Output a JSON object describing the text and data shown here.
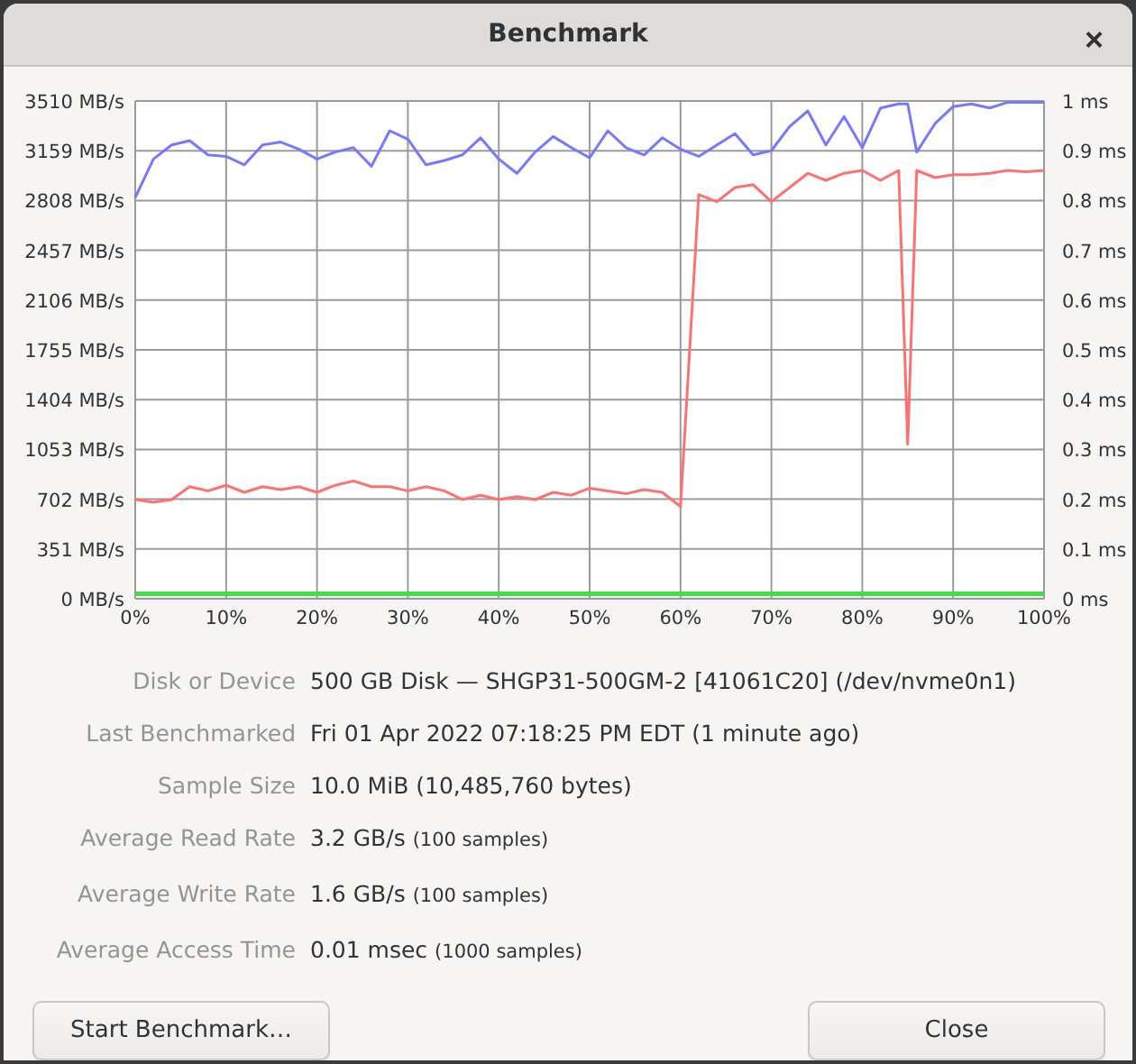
{
  "window": {
    "title": "Benchmark",
    "close": "×"
  },
  "chart": {
    "chart_data": {
      "type": "line",
      "x": [
        0,
        2,
        4,
        6,
        8,
        10,
        12,
        14,
        16,
        18,
        20,
        22,
        24,
        26,
        28,
        30,
        32,
        34,
        36,
        38,
        40,
        42,
        44,
        46,
        48,
        50,
        52,
        54,
        56,
        58,
        60,
        62,
        64,
        66,
        68,
        70,
        72,
        74,
        76,
        78,
        80,
        82,
        84,
        85,
        86,
        88,
        90,
        92,
        94,
        96,
        98,
        100
      ],
      "grid": true,
      "xlim": [
        0,
        100
      ],
      "ylim": [
        0,
        3510
      ],
      "xticks": [
        {
          "value": 0,
          "label": "0%"
        },
        {
          "value": 10,
          "label": "10%"
        },
        {
          "value": 20,
          "label": "20%"
        },
        {
          "value": 30,
          "label": "30%"
        },
        {
          "value": 40,
          "label": "40%"
        },
        {
          "value": 50,
          "label": "50%"
        },
        {
          "value": 60,
          "label": "60%"
        },
        {
          "value": 70,
          "label": "70%"
        },
        {
          "value": 80,
          "label": "80%"
        },
        {
          "value": 90,
          "label": "90%"
        },
        {
          "value": 100,
          "label": "100%"
        }
      ],
      "yticks": [
        {
          "value": 0,
          "label": "0 MB/s"
        },
        {
          "value": 351,
          "label": "351 MB/s"
        },
        {
          "value": 702,
          "label": "702 MB/s"
        },
        {
          "value": 1053,
          "label": "1053 MB/s"
        },
        {
          "value": 1404,
          "label": "1404 MB/s"
        },
        {
          "value": 1755,
          "label": "1755 MB/s"
        },
        {
          "value": 2106,
          "label": "2106 MB/s"
        },
        {
          "value": 2457,
          "label": "2457 MB/s"
        },
        {
          "value": 2808,
          "label": "2808 MB/s"
        },
        {
          "value": 3159,
          "label": "3159 MB/s"
        },
        {
          "value": 3510,
          "label": "3510 MB/s"
        }
      ],
      "y2lim": [
        0,
        1
      ],
      "y2ticks": [
        {
          "value": 0,
          "label": "0 ms"
        },
        {
          "value": 0.1,
          "label": "0.1 ms"
        },
        {
          "value": 0.2,
          "label": "0.2 ms"
        },
        {
          "value": 0.3,
          "label": "0.3 ms"
        },
        {
          "value": 0.4,
          "label": "0.4 ms"
        },
        {
          "value": 0.5,
          "label": "0.5 ms"
        },
        {
          "value": 0.6,
          "label": "0.6 ms"
        },
        {
          "value": 0.7,
          "label": "0.7 ms"
        },
        {
          "value": 0.8,
          "label": "0.8 ms"
        },
        {
          "value": 0.9,
          "label": "0.9 ms"
        },
        {
          "value": 1,
          "label": "1 ms"
        }
      ],
      "series": [
        {
          "color": "#7878ff",
          "values": [
            2830,
            3100,
            3200,
            3230,
            3130,
            3120,
            3060,
            3200,
            3220,
            3170,
            3100,
            3150,
            3180,
            3050,
            3300,
            3240,
            3060,
            3090,
            3130,
            3250,
            3100,
            3000,
            3150,
            3260,
            3180,
            3110,
            3300,
            3180,
            3130,
            3250,
            3170,
            3120,
            3200,
            3280,
            3130,
            3160,
            3330,
            3440,
            3200,
            3400,
            3180,
            3460,
            3490,
            3490,
            3150,
            3350,
            3470,
            3490,
            3460,
            3500,
            3500,
            3500
          ]
        },
        {
          "color": "#ff7070",
          "values": [
            700,
            680,
            700,
            790,
            760,
            800,
            750,
            790,
            770,
            790,
            750,
            800,
            830,
            790,
            790,
            760,
            790,
            760,
            700,
            730,
            700,
            720,
            700,
            750,
            730,
            780,
            760,
            740,
            770,
            750,
            650,
            2850,
            2800,
            2900,
            2920,
            2800,
            2900,
            3000,
            2950,
            3000,
            3020,
            2950,
            3020,
            1090,
            3020,
            2970,
            2990,
            2990,
            3000,
            3020,
            3010,
            3020
          ]
        },
        {
          "color": "#40e040",
          "axis": "y2",
          "values": [
            0.01,
            0.01,
            0.01,
            0.01,
            0.01,
            0.01,
            0.01,
            0.01,
            0.01,
            0.01,
            0.01,
            0.01,
            0.01,
            0.01,
            0.01,
            0.01,
            0.01,
            0.01,
            0.01,
            0.01,
            0.01,
            0.01,
            0.01,
            0.01,
            0.01,
            0.01,
            0.01,
            0.01,
            0.01,
            0.01,
            0.01,
            0.01,
            0.01,
            0.01,
            0.01,
            0.01,
            0.01,
            0.01,
            0.01,
            0.01,
            0.01,
            0.01,
            0.01,
            0.01,
            0.01,
            0.01,
            0.01,
            0.01,
            0.01,
            0.01,
            0.01,
            0.01
          ]
        }
      ]
    }
  },
  "info": [
    {
      "label": "Disk or Device",
      "value": "500 GB Disk — SHGP31-500GM-2 [41061C20] (/dev/nvme0n1)"
    },
    {
      "label": "Last Benchmarked",
      "value": "Fri 01 Apr 2022 07:18:25 PM EDT (1 minute ago)"
    },
    {
      "label": "Sample Size",
      "value": "10.0 MiB (10,485,760 bytes)"
    },
    {
      "label": "Average Read Rate",
      "value": "3.2 GB/s",
      "note": "(100 samples)"
    },
    {
      "label": "Average Write Rate",
      "value": "1.6 GB/s",
      "note": "(100 samples)"
    },
    {
      "label": "Average Access Time",
      "value": "0.01 msec",
      "note": "(1000 samples)"
    }
  ],
  "buttons": [
    {
      "label": "Start Benchmark…"
    },
    {
      "label": "Close"
    }
  ]
}
